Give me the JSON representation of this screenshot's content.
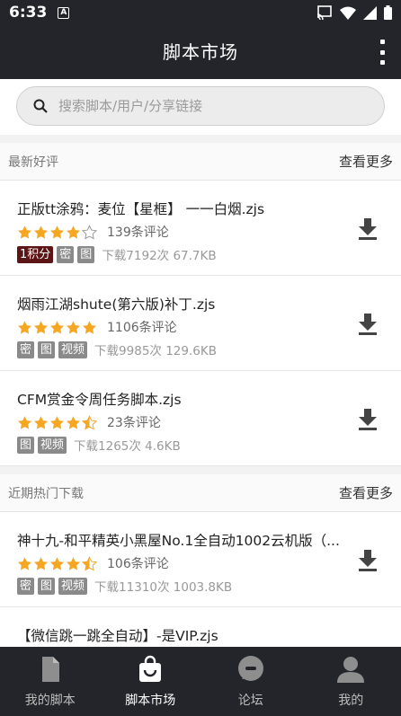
{
  "status": {
    "time": "6:33",
    "notif_letter": "A"
  },
  "appbar": {
    "title": "脚本市场"
  },
  "search": {
    "placeholder": "搜索脚本/用户/分享链接"
  },
  "sections": [
    {
      "label": "最新好评",
      "more": "查看更多",
      "items": [
        {
          "name": "正版tt涂鸦：麦位【星框】 一一白烟.zjs",
          "stars": 4,
          "reviews": "139条评论",
          "tags": [
            "1积分",
            "密",
            "图"
          ],
          "stats": "下载7192次 67.7KB"
        },
        {
          "name": "烟雨江湖shute(第六版)补丁.zjs",
          "stars": 5,
          "reviews": "1106条评论",
          "tags": [
            "密",
            "图",
            "视频"
          ],
          "stats": "下载9985次 129.6KB"
        },
        {
          "name": "CFM赏金令周任务脚本.zjs",
          "stars": 4.5,
          "reviews": "23条评论",
          "tags": [
            "图",
            "视频"
          ],
          "stats": "下载1265次 4.6KB"
        }
      ]
    },
    {
      "label": "近期热门下载",
      "more": "查看更多",
      "items": [
        {
          "name": "神十九-和平精英小黑屋No.1全自动1002云机版（...",
          "stars": 4.5,
          "reviews": "106条评论",
          "tags": [
            "密",
            "图",
            "视频"
          ],
          "stats": "下载11310次 1003.8KB"
        }
      ],
      "partial_item": "【微信跳一跳全自动】-是VIP.zjs"
    }
  ],
  "nav": [
    {
      "label": "我的脚本",
      "icon": "file-icon",
      "active": false
    },
    {
      "label": "脚本市场",
      "icon": "shopping-bag-icon",
      "active": true
    },
    {
      "label": "论坛",
      "icon": "chat-bubble-icon",
      "active": false
    },
    {
      "label": "我的",
      "icon": "person-icon",
      "active": false
    }
  ],
  "colors": {
    "bar": "#23252b",
    "star": "#f5a623",
    "points_tag": "#5c1414",
    "tag": "#8a8a8a"
  }
}
